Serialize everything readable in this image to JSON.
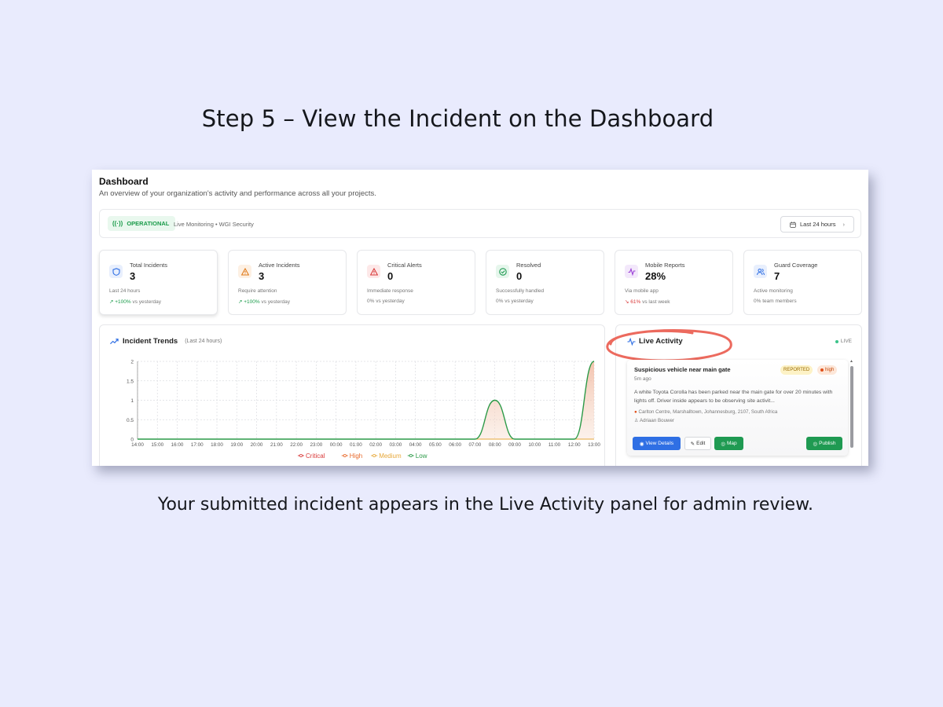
{
  "step_title": "Step 5 – View the Incident on the Dashboard",
  "caption": "Your submitted incident appears in the Live Activity panel for admin review.",
  "dashboard": {
    "title": "Dashboard",
    "subtitle": "An overview of your organization's activity and performance across all your projects."
  },
  "status_bar": {
    "status": "OPERATIONAL",
    "monitoring": "Live Monitoring • WGI Security",
    "range_label": "Last 24 hours"
  },
  "stats": [
    {
      "label": "Total Incidents",
      "value": "3",
      "note": "Last 24 hours",
      "trend": "+100%",
      "trend_suffix": "vs yesterday",
      "trend_dir": "up",
      "icon": "shield-icon",
      "color": "#2f6fe4",
      "bg": "#e8effd"
    },
    {
      "label": "Active Incidents",
      "value": "3",
      "note": "Require attention",
      "trend": "+100%",
      "trend_suffix": "vs yesterday",
      "trend_dir": "up",
      "icon": "warning-icon",
      "color": "#e07a1a",
      "bg": "#fdf0e3"
    },
    {
      "label": "Critical Alerts",
      "value": "0",
      "note": "Immediate response",
      "trend": "0%",
      "trend_suffix": "vs yesterday",
      "trend_dir": "flat",
      "icon": "alert-triangle-icon",
      "color": "#d93a3a",
      "bg": "#fde8e8"
    },
    {
      "label": "Resolved",
      "value": "0",
      "note": "Successfully handled",
      "trend": "0%",
      "trend_suffix": "vs yesterday",
      "trend_dir": "flat",
      "icon": "check-circle-icon",
      "color": "#1f9a52",
      "bg": "#e6f6ec"
    },
    {
      "label": "Mobile Reports",
      "value": "28%",
      "note": "Via mobile app",
      "trend": "61%",
      "trend_suffix": "vs last week",
      "trend_dir": "down",
      "icon": "activity-icon",
      "color": "#9a3fd6",
      "bg": "#f3e8fb"
    },
    {
      "label": "Guard Coverage",
      "value": "7",
      "note": "Active monitoring",
      "trend": "0%",
      "trend_suffix": "team members",
      "trend_dir": "flat",
      "icon": "users-icon",
      "color": "#2f6fe4",
      "bg": "#e8effd"
    }
  ],
  "incident_trends": {
    "title": "Incident Trends",
    "subtitle": "(Last 24 hours)"
  },
  "chart_data": {
    "type": "area",
    "title": "Incident Trends",
    "x": [
      "14:00",
      "15:00",
      "16:00",
      "17:00",
      "18:00",
      "19:00",
      "20:00",
      "21:00",
      "22:00",
      "23:00",
      "00:00",
      "01:00",
      "02:00",
      "03:00",
      "04:00",
      "05:00",
      "06:00",
      "07:00",
      "08:00",
      "09:00",
      "10:00",
      "11:00",
      "12:00",
      "13:00"
    ],
    "ylim": [
      0,
      2
    ],
    "yticks": [
      "0",
      "0.5",
      "1",
      "1.5",
      "2"
    ],
    "grid": true,
    "legend_position": "bottom",
    "series": [
      {
        "name": "Critical",
        "color": "#d93a3a",
        "values": [
          0,
          0,
          0,
          0,
          0,
          0,
          0,
          0,
          0,
          0,
          0,
          0,
          0,
          0,
          0,
          0,
          0,
          0,
          0,
          0,
          0,
          0,
          0,
          0
        ]
      },
      {
        "name": "High",
        "color": "#e8692a",
        "values": [
          0,
          0,
          0,
          0,
          0,
          0,
          0,
          0,
          0,
          0,
          0,
          0,
          0,
          0,
          0,
          0,
          0,
          0,
          0,
          0,
          0,
          0,
          0,
          0
        ]
      },
      {
        "name": "Medium",
        "color": "#e7a83a",
        "values": [
          0,
          0,
          0,
          0,
          0,
          0,
          0,
          0,
          0,
          0,
          0,
          0,
          0,
          0,
          0,
          0,
          0,
          0,
          0,
          0,
          0,
          0,
          0,
          0
        ]
      },
      {
        "name": "Low",
        "color": "#2c9a48",
        "values": [
          0,
          0,
          0,
          0,
          0,
          0,
          0,
          0,
          0,
          0,
          0,
          0,
          0,
          0,
          0,
          0,
          0,
          0,
          1,
          0,
          0,
          0,
          0,
          2
        ]
      }
    ]
  },
  "live_activity": {
    "title": "Live Activity",
    "live_label": "LIVE",
    "incident": {
      "title": "Suspicious vehicle near main gate",
      "time_ago": "5m ago",
      "status": "REPORTED",
      "severity": "high",
      "description": "A white Toyota Corolla has been parked near the main gate for over 20 minutes with lights off. Driver inside appears to be observing site activit...",
      "location": "Carlton Centre, Marshalltown, Johannesburg, 2107, South Africa",
      "reporter": "Adriaan Bouwer",
      "view_label": "View Details",
      "edit_label": "Edit",
      "map_label": "Map",
      "publish_label": "Publish"
    }
  }
}
